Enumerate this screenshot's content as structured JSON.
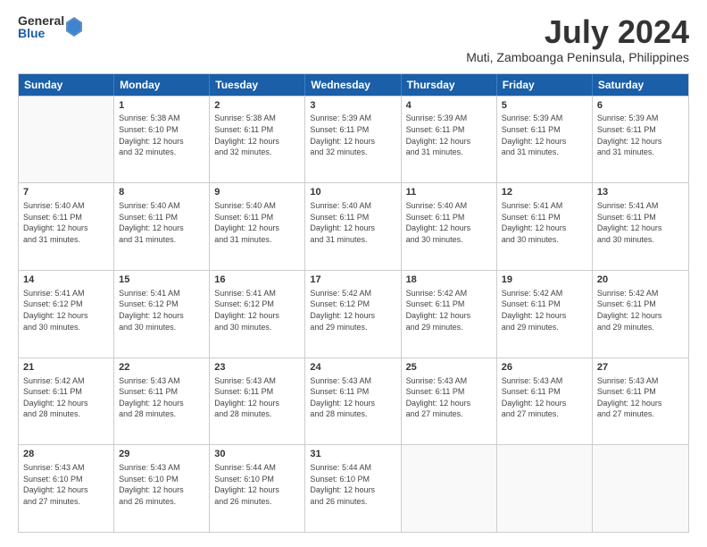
{
  "logo": {
    "general": "General",
    "blue": "Blue"
  },
  "title": "July 2024",
  "subtitle": "Muti, Zamboanga Peninsula, Philippines",
  "header_days": [
    "Sunday",
    "Monday",
    "Tuesday",
    "Wednesday",
    "Thursday",
    "Friday",
    "Saturday"
  ],
  "weeks": [
    [
      {
        "day": "",
        "sunrise": "",
        "sunset": "",
        "daylight": ""
      },
      {
        "day": "1",
        "sunrise": "Sunrise: 5:38 AM",
        "sunset": "Sunset: 6:10 PM",
        "daylight": "Daylight: 12 hours and 32 minutes."
      },
      {
        "day": "2",
        "sunrise": "Sunrise: 5:38 AM",
        "sunset": "Sunset: 6:11 PM",
        "daylight": "Daylight: 12 hours and 32 minutes."
      },
      {
        "day": "3",
        "sunrise": "Sunrise: 5:39 AM",
        "sunset": "Sunset: 6:11 PM",
        "daylight": "Daylight: 12 hours and 32 minutes."
      },
      {
        "day": "4",
        "sunrise": "Sunrise: 5:39 AM",
        "sunset": "Sunset: 6:11 PM",
        "daylight": "Daylight: 12 hours and 31 minutes."
      },
      {
        "day": "5",
        "sunrise": "Sunrise: 5:39 AM",
        "sunset": "Sunset: 6:11 PM",
        "daylight": "Daylight: 12 hours and 31 minutes."
      },
      {
        "day": "6",
        "sunrise": "Sunrise: 5:39 AM",
        "sunset": "Sunset: 6:11 PM",
        "daylight": "Daylight: 12 hours and 31 minutes."
      }
    ],
    [
      {
        "day": "7",
        "sunrise": "Sunrise: 5:40 AM",
        "sunset": "Sunset: 6:11 PM",
        "daylight": "Daylight: 12 hours and 31 minutes."
      },
      {
        "day": "8",
        "sunrise": "Sunrise: 5:40 AM",
        "sunset": "Sunset: 6:11 PM",
        "daylight": "Daylight: 12 hours and 31 minutes."
      },
      {
        "day": "9",
        "sunrise": "Sunrise: 5:40 AM",
        "sunset": "Sunset: 6:11 PM",
        "daylight": "Daylight: 12 hours and 31 minutes."
      },
      {
        "day": "10",
        "sunrise": "Sunrise: 5:40 AM",
        "sunset": "Sunset: 6:11 PM",
        "daylight": "Daylight: 12 hours and 31 minutes."
      },
      {
        "day": "11",
        "sunrise": "Sunrise: 5:40 AM",
        "sunset": "Sunset: 6:11 PM",
        "daylight": "Daylight: 12 hours and 30 minutes."
      },
      {
        "day": "12",
        "sunrise": "Sunrise: 5:41 AM",
        "sunset": "Sunset: 6:11 PM",
        "daylight": "Daylight: 12 hours and 30 minutes."
      },
      {
        "day": "13",
        "sunrise": "Sunrise: 5:41 AM",
        "sunset": "Sunset: 6:11 PM",
        "daylight": "Daylight: 12 hours and 30 minutes."
      }
    ],
    [
      {
        "day": "14",
        "sunrise": "Sunrise: 5:41 AM",
        "sunset": "Sunset: 6:12 PM",
        "daylight": "Daylight: 12 hours and 30 minutes."
      },
      {
        "day": "15",
        "sunrise": "Sunrise: 5:41 AM",
        "sunset": "Sunset: 6:12 PM",
        "daylight": "Daylight: 12 hours and 30 minutes."
      },
      {
        "day": "16",
        "sunrise": "Sunrise: 5:41 AM",
        "sunset": "Sunset: 6:12 PM",
        "daylight": "Daylight: 12 hours and 30 minutes."
      },
      {
        "day": "17",
        "sunrise": "Sunrise: 5:42 AM",
        "sunset": "Sunset: 6:12 PM",
        "daylight": "Daylight: 12 hours and 29 minutes."
      },
      {
        "day": "18",
        "sunrise": "Sunrise: 5:42 AM",
        "sunset": "Sunset: 6:11 PM",
        "daylight": "Daylight: 12 hours and 29 minutes."
      },
      {
        "day": "19",
        "sunrise": "Sunrise: 5:42 AM",
        "sunset": "Sunset: 6:11 PM",
        "daylight": "Daylight: 12 hours and 29 minutes."
      },
      {
        "day": "20",
        "sunrise": "Sunrise: 5:42 AM",
        "sunset": "Sunset: 6:11 PM",
        "daylight": "Daylight: 12 hours and 29 minutes."
      }
    ],
    [
      {
        "day": "21",
        "sunrise": "Sunrise: 5:42 AM",
        "sunset": "Sunset: 6:11 PM",
        "daylight": "Daylight: 12 hours and 28 minutes."
      },
      {
        "day": "22",
        "sunrise": "Sunrise: 5:43 AM",
        "sunset": "Sunset: 6:11 PM",
        "daylight": "Daylight: 12 hours and 28 minutes."
      },
      {
        "day": "23",
        "sunrise": "Sunrise: 5:43 AM",
        "sunset": "Sunset: 6:11 PM",
        "daylight": "Daylight: 12 hours and 28 minutes."
      },
      {
        "day": "24",
        "sunrise": "Sunrise: 5:43 AM",
        "sunset": "Sunset: 6:11 PM",
        "daylight": "Daylight: 12 hours and 28 minutes."
      },
      {
        "day": "25",
        "sunrise": "Sunrise: 5:43 AM",
        "sunset": "Sunset: 6:11 PM",
        "daylight": "Daylight: 12 hours and 27 minutes."
      },
      {
        "day": "26",
        "sunrise": "Sunrise: 5:43 AM",
        "sunset": "Sunset: 6:11 PM",
        "daylight": "Daylight: 12 hours and 27 minutes."
      },
      {
        "day": "27",
        "sunrise": "Sunrise: 5:43 AM",
        "sunset": "Sunset: 6:11 PM",
        "daylight": "Daylight: 12 hours and 27 minutes."
      }
    ],
    [
      {
        "day": "28",
        "sunrise": "Sunrise: 5:43 AM",
        "sunset": "Sunset: 6:10 PM",
        "daylight": "Daylight: 12 hours and 27 minutes."
      },
      {
        "day": "29",
        "sunrise": "Sunrise: 5:43 AM",
        "sunset": "Sunset: 6:10 PM",
        "daylight": "Daylight: 12 hours and 26 minutes."
      },
      {
        "day": "30",
        "sunrise": "Sunrise: 5:44 AM",
        "sunset": "Sunset: 6:10 PM",
        "daylight": "Daylight: 12 hours and 26 minutes."
      },
      {
        "day": "31",
        "sunrise": "Sunrise: 5:44 AM",
        "sunset": "Sunset: 6:10 PM",
        "daylight": "Daylight: 12 hours and 26 minutes."
      },
      {
        "day": "",
        "sunrise": "",
        "sunset": "",
        "daylight": ""
      },
      {
        "day": "",
        "sunrise": "",
        "sunset": "",
        "daylight": ""
      },
      {
        "day": "",
        "sunrise": "",
        "sunset": "",
        "daylight": ""
      }
    ]
  ]
}
